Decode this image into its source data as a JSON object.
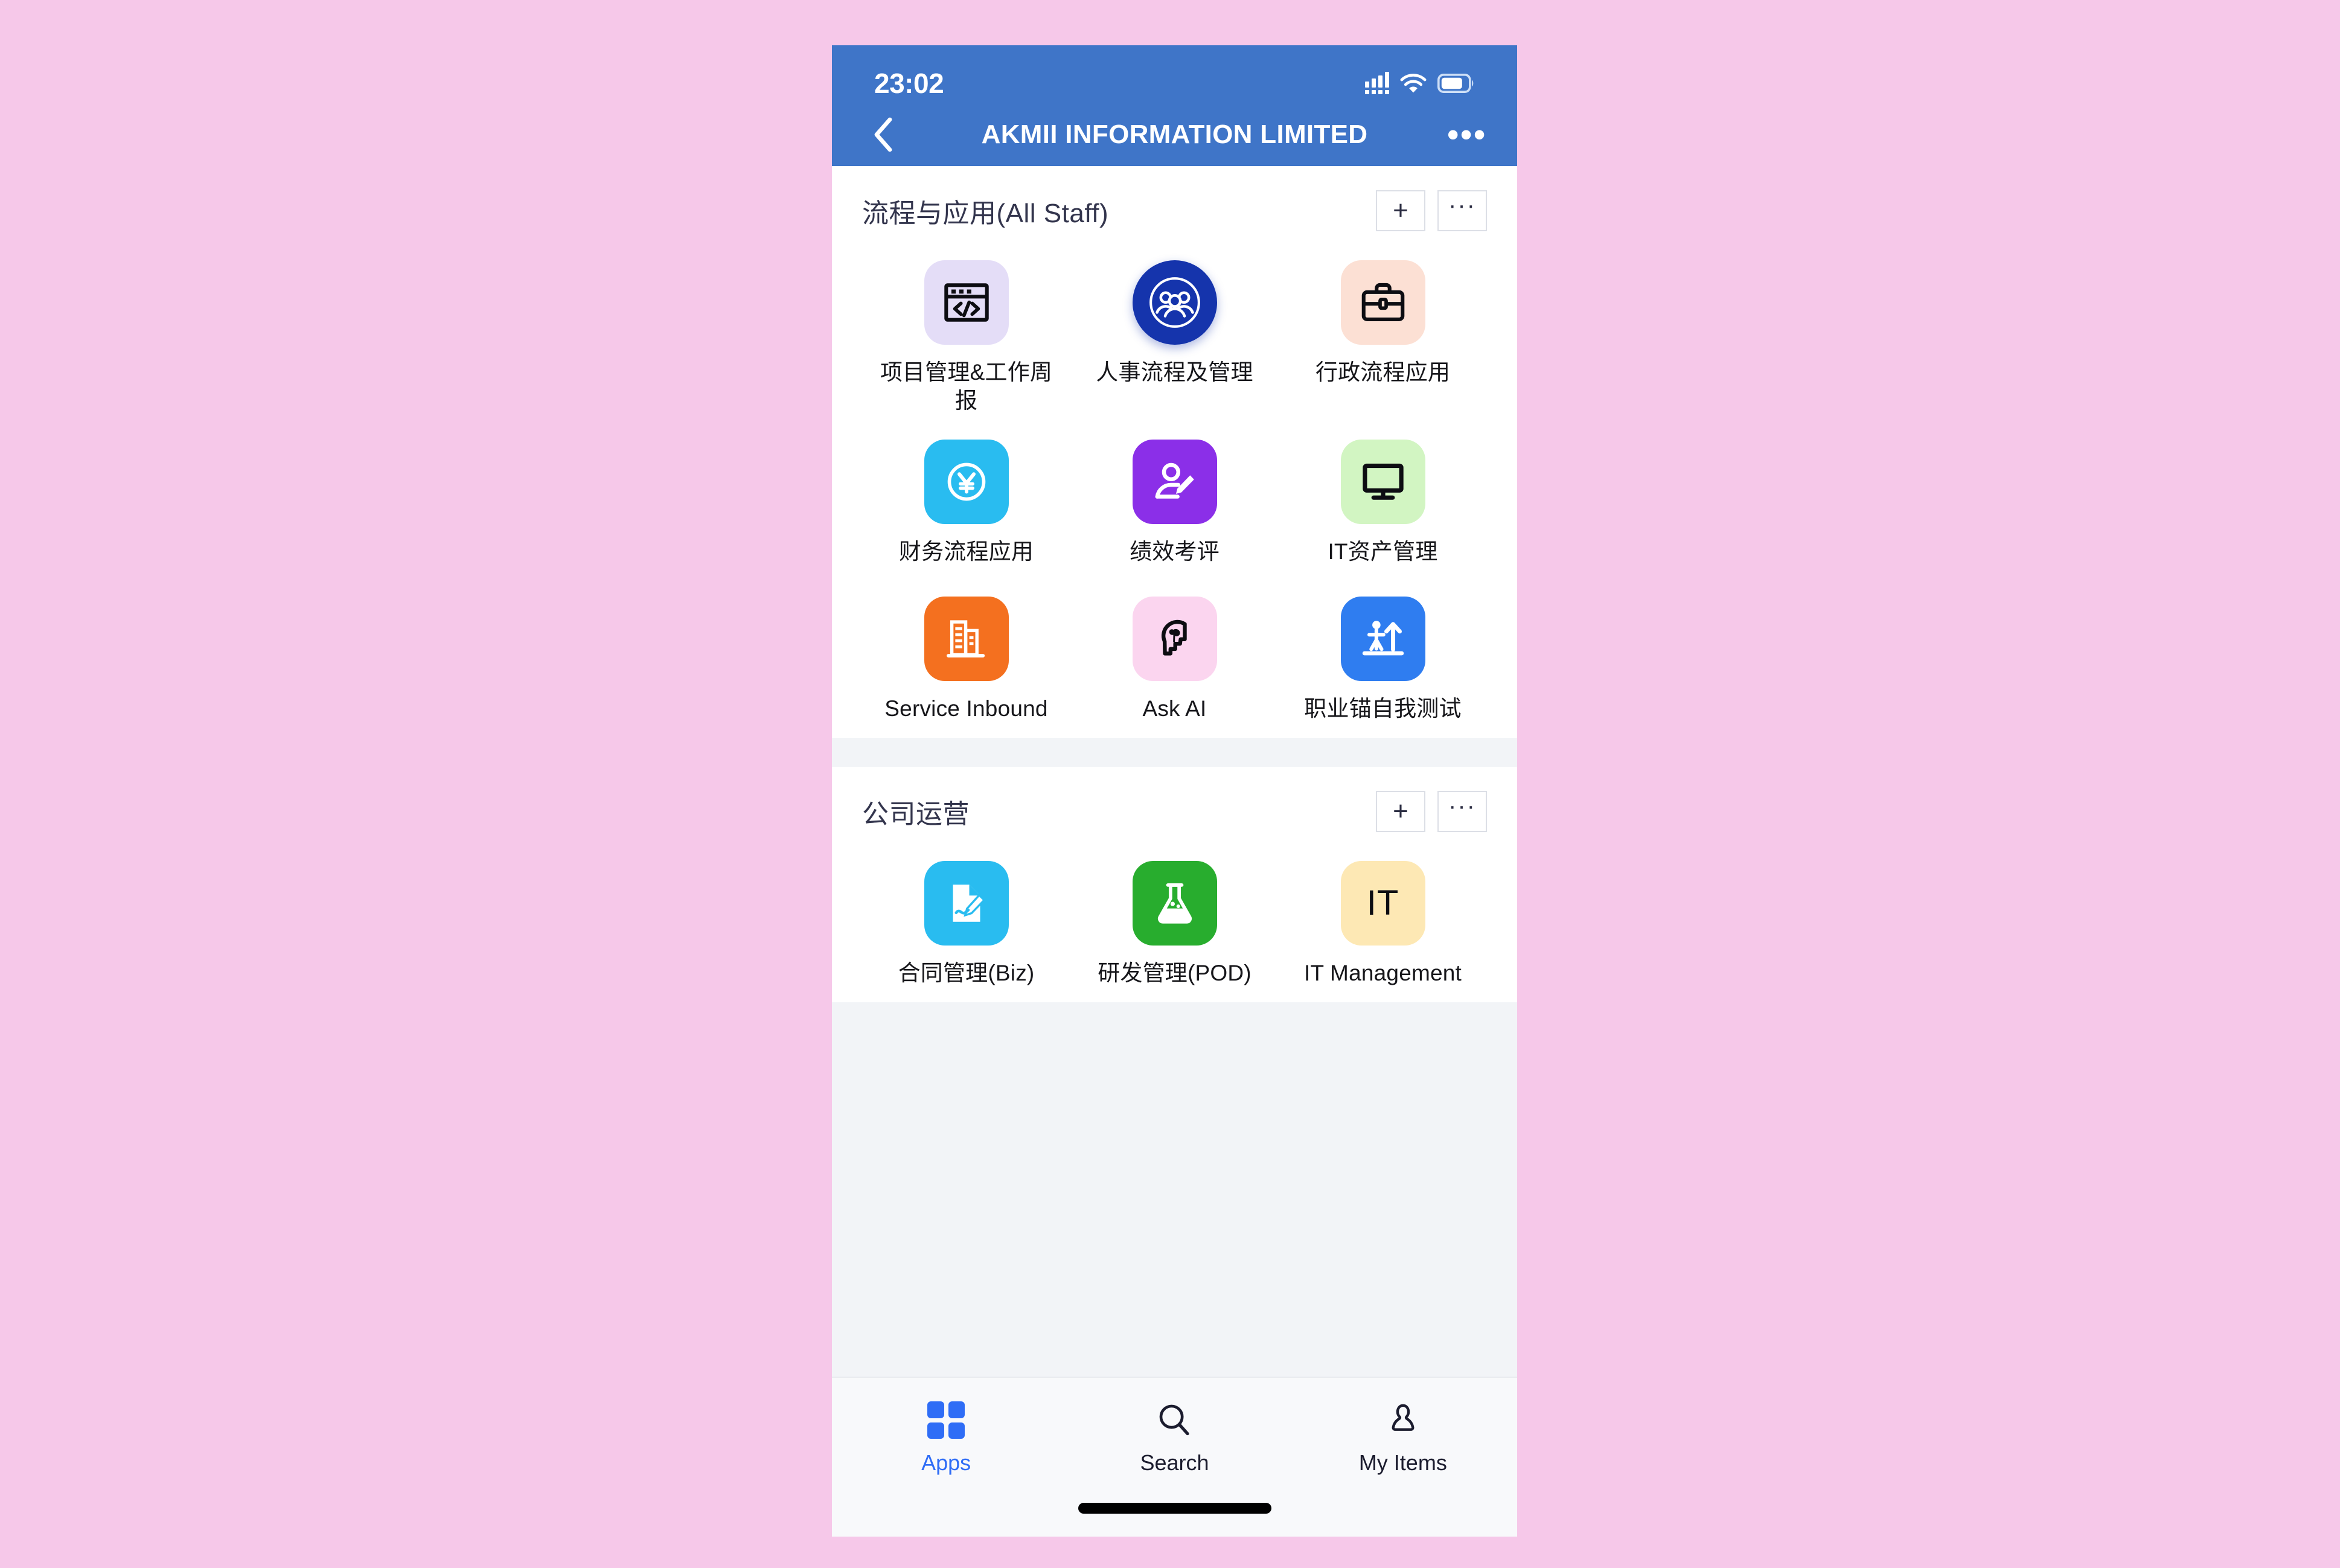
{
  "status_bar": {
    "time": "23:02",
    "signal_icon": "cellular-signal-icon",
    "wifi_icon": "wifi-icon",
    "battery_icon": "battery-icon"
  },
  "nav": {
    "back_icon": "chevron-left-icon",
    "title": "AKMII INFORMATION LIMITED",
    "more_label": "•••"
  },
  "theme": {
    "page_background": "#f6c8e9",
    "header_blue": "#3f75c8",
    "accent_blue": "#2f6df6",
    "card_white": "#ffffff",
    "gap_gray": "#f2f4f7"
  },
  "sections": [
    {
      "title": "流程与应用(All Staff)",
      "add_label": "+",
      "more_label": "···",
      "apps": [
        {
          "label": "项目管理&工作周报",
          "icon": "code-window-icon",
          "bg": "#e4ddf7",
          "fg": "#0d0d12",
          "shape": "rounded"
        },
        {
          "label": "人事流程及管理",
          "icon": "people-group-icon",
          "bg": "#1534ac",
          "fg": "#ffffff",
          "shape": "circle"
        },
        {
          "label": "行政流程应用",
          "icon": "briefcase-icon",
          "bg": "#fce0d4",
          "fg": "#0d0d12",
          "shape": "rounded"
        },
        {
          "label": "财务流程应用",
          "icon": "yuan-coin-icon",
          "bg": "#29bcf0",
          "fg": "#ffffff",
          "shape": "rounded"
        },
        {
          "label": "绩效考评",
          "icon": "user-edit-icon",
          "bg": "#8b2fe8",
          "fg": "#ffffff",
          "shape": "rounded"
        },
        {
          "label": "IT资产管理",
          "icon": "monitor-icon",
          "bg": "#d2f5c2",
          "fg": "#0d0d12",
          "shape": "rounded"
        },
        {
          "label": "Service Inbound",
          "icon": "office-building-icon",
          "bg": "#f4701f",
          "fg": "#ffffff",
          "shape": "rounded"
        },
        {
          "label": "Ask AI",
          "icon": "brain-head-icon",
          "bg": "#fbd5ef",
          "fg": "#0d0d12",
          "shape": "rounded"
        },
        {
          "label": "职业锚自我测试",
          "icon": "person-growth-arrow-icon",
          "bg": "#2f7df0",
          "fg": "#ffffff",
          "shape": "rounded"
        }
      ]
    },
    {
      "title": "公司运营",
      "add_label": "+",
      "more_label": "···",
      "apps": [
        {
          "label": "合同管理(Biz)",
          "icon": "contract-sign-icon",
          "bg": "#29bcf0",
          "fg": "#ffffff",
          "shape": "rounded"
        },
        {
          "label": "研发管理(POD)",
          "icon": "flask-icon",
          "bg": "#28ad2e",
          "fg": "#ffffff",
          "shape": "rounded"
        },
        {
          "label": "IT Management",
          "icon": "it-text-icon",
          "bg": "#fde8b4",
          "fg": "#0d0d12",
          "shape": "rounded",
          "text_glyph": "IT"
        }
      ]
    }
  ],
  "tab_bar": {
    "tabs": [
      {
        "label": "Apps",
        "icon": "apps-grid-icon",
        "active": true
      },
      {
        "label": "Search",
        "icon": "search-icon",
        "active": false
      },
      {
        "label": "My Items",
        "icon": "person-icon",
        "active": false
      }
    ]
  }
}
